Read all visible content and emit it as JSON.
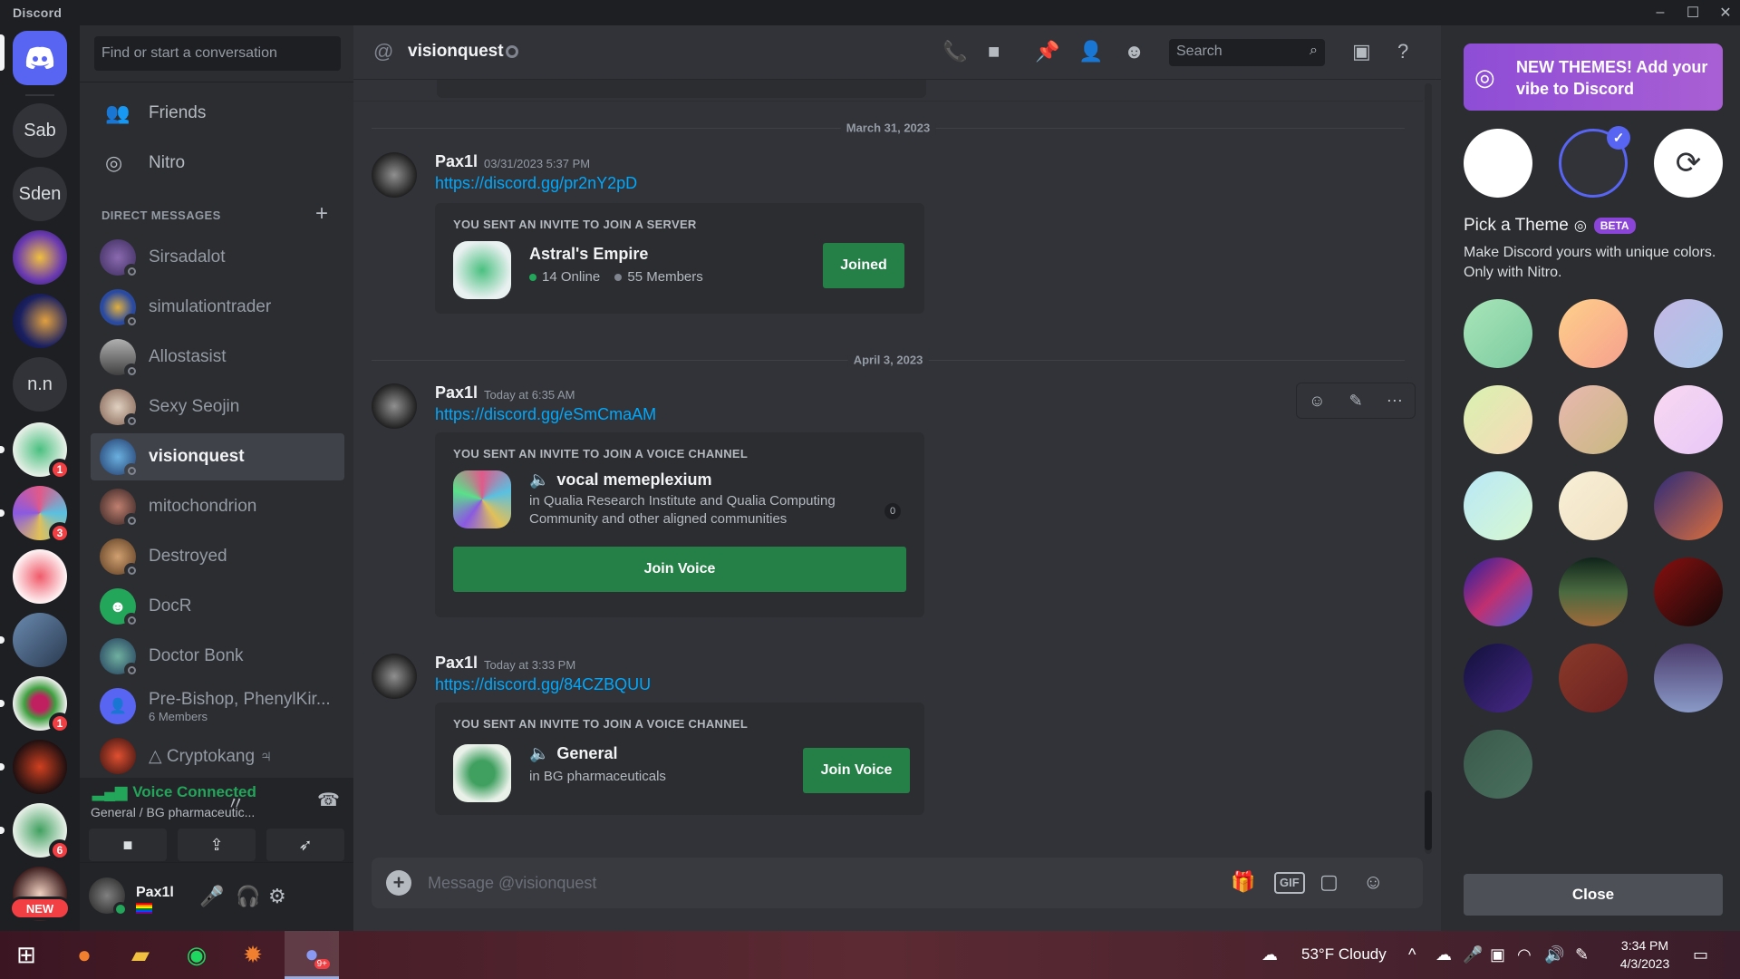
{
  "app": {
    "brand": "Discord"
  },
  "rail": {
    "servers": [
      {
        "label": "Sab"
      },
      {
        "label": "Sden"
      },
      {
        "label": "n.n"
      }
    ],
    "badges": [
      "1",
      "3",
      "1",
      "6"
    ],
    "new_label": "NEW"
  },
  "dm_sidebar": {
    "search_placeholder": "Find or start a conversation",
    "nav": [
      {
        "label": "Friends"
      },
      {
        "label": "Nitro"
      }
    ],
    "heading": "DIRECT MESSAGES",
    "dms": [
      {
        "name": "Sirsadalot"
      },
      {
        "name": "simulationtrader"
      },
      {
        "name": "Allostasist"
      },
      {
        "name": "Sexy Seojin"
      },
      {
        "name": "visionquest"
      },
      {
        "name": "mitochondrion"
      },
      {
        "name": "Destroyed"
      },
      {
        "name": "DocR"
      },
      {
        "name": "Doctor Bonk"
      },
      {
        "name": "Pre-Bishop, PhenylKir...",
        "sub": "6 Members"
      },
      {
        "name": "△ Cryptokang ♃"
      }
    ]
  },
  "voice": {
    "status": "Voice Connected",
    "channel": "General / BG pharmaceutic..."
  },
  "user": {
    "name": "Pax1l"
  },
  "chat": {
    "channel": "visionquest",
    "search_placeholder": "Search",
    "composer_placeholder": "Message @visionquest",
    "gif_label": "GIF",
    "dates": [
      "March 31, 2023",
      "April 3, 2023"
    ],
    "messages": [
      {
        "author": "Pax1l",
        "time": "03/31/2023 5:37 PM",
        "link": "https://discord.gg/pr2nY2pD",
        "invite": {
          "header": "YOU SENT AN INVITE TO JOIN A SERVER",
          "name": "Astral's Empire",
          "online": "14 Online",
          "members": "55 Members",
          "button": "Joined"
        }
      },
      {
        "author": "Pax1l",
        "time": "Today at 6:35 AM",
        "link": "https://discord.gg/eSmCmaAM",
        "invite": {
          "header": "YOU SENT AN INVITE TO JOIN A VOICE CHANNEL",
          "name": "vocal memeplexium",
          "desc": "in Qualia Research Institute and Qualia Computing Community and other aligned communities",
          "count": "0",
          "button": "Join Voice"
        }
      },
      {
        "author": "Pax1l",
        "time": "Today at 3:33 PM",
        "link": "https://discord.gg/84CZBQUU",
        "invite": {
          "header": "YOU SENT AN INVITE TO JOIN A VOICE CHANNEL",
          "name": "General",
          "desc": "in BG pharmaceuticals",
          "button": "Join Voice"
        }
      }
    ]
  },
  "theme_panel": {
    "promo": "NEW THEMES! Add your vibe to Discord",
    "pick_title": "Pick a Theme",
    "beta": "BETA",
    "description": "Make Discord yours with unique colors. Only with Nitro.",
    "close": "Close",
    "swatches": [
      "linear-gradient(135deg,#a8e6b8,#7cc9a0)",
      "linear-gradient(135deg,#ffd08a,#f5a08e)",
      "linear-gradient(135deg,#c5b8e6,#a5c8e8)",
      "linear-gradient(135deg,#d8f2b0,#f8d8b8)",
      "linear-gradient(135deg,#e8b8b0,#c8b880)",
      "linear-gradient(135deg,#f8d8f0,#e8c8f8)",
      "linear-gradient(135deg,#b8e8f8,#d8f8d0)",
      "linear-gradient(135deg,#f8f0d8,#f0e0c0)",
      "linear-gradient(135deg,#2a2a7a,#e0703a)",
      "linear-gradient(135deg,#2020a0,#c03070,#3a60e0)",
      "linear-gradient(180deg,#10241a,#4a6a40,#a06a3a)",
      "linear-gradient(135deg,#8a1010,#100808)",
      "linear-gradient(135deg,#10103a,#4a2a8a)",
      "linear-gradient(135deg,#8a3a2a,#6a2020)",
      "linear-gradient(180deg,#4a3a6a,#8a9ac8)",
      "linear-gradient(135deg,#3a5a4a,#4a7060)"
    ]
  },
  "taskbar": {
    "weather": "53°F  Cloudy",
    "time": "3:34 PM",
    "date": "4/3/2023",
    "discord_badge": "9+"
  }
}
